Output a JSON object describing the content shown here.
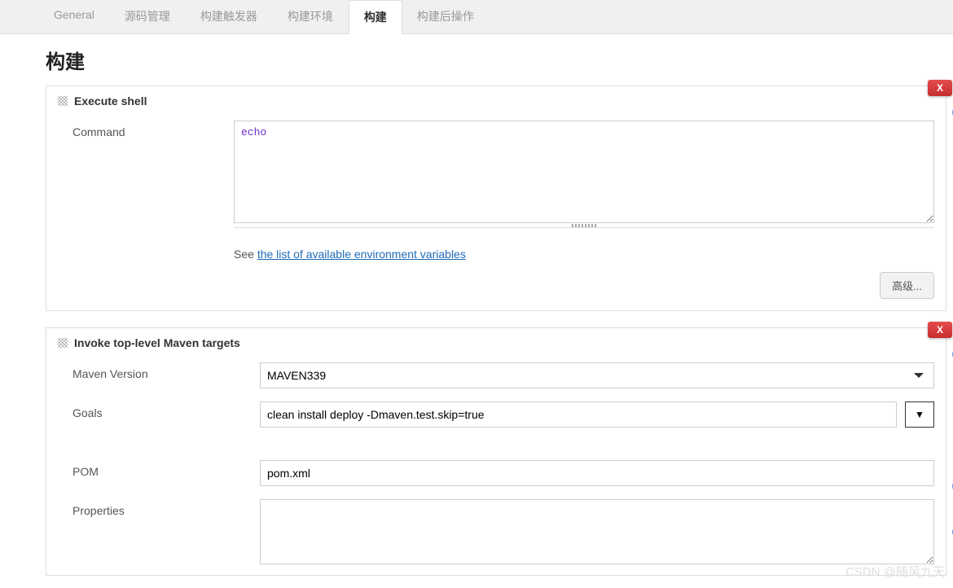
{
  "tabs": {
    "t0": "General",
    "t1": "源码管理",
    "t2": "构建触发器",
    "t3": "构建环境",
    "t4": "构建",
    "t5": "构建后操作"
  },
  "section_title": "构建",
  "shell": {
    "header": "Execute shell",
    "command_label": "Command",
    "command_value": "echo",
    "hint_prefix": "See ",
    "hint_link": "the list of available environment variables",
    "delete_label": "X",
    "advanced_label": "高级..."
  },
  "maven": {
    "header": "Invoke top-level Maven targets",
    "version_label": "Maven Version",
    "version_value": "MAVEN339",
    "goals_label": "Goals",
    "goals_value": "clean install deploy -Dmaven.test.skip=true",
    "pom_label": "POM",
    "pom_value": "pom.xml",
    "properties_label": "Properties",
    "properties_value": "",
    "delete_label": "X",
    "expand_glyph": "▼"
  },
  "help_glyph": "?",
  "watermark": "CSDN @随风九天"
}
